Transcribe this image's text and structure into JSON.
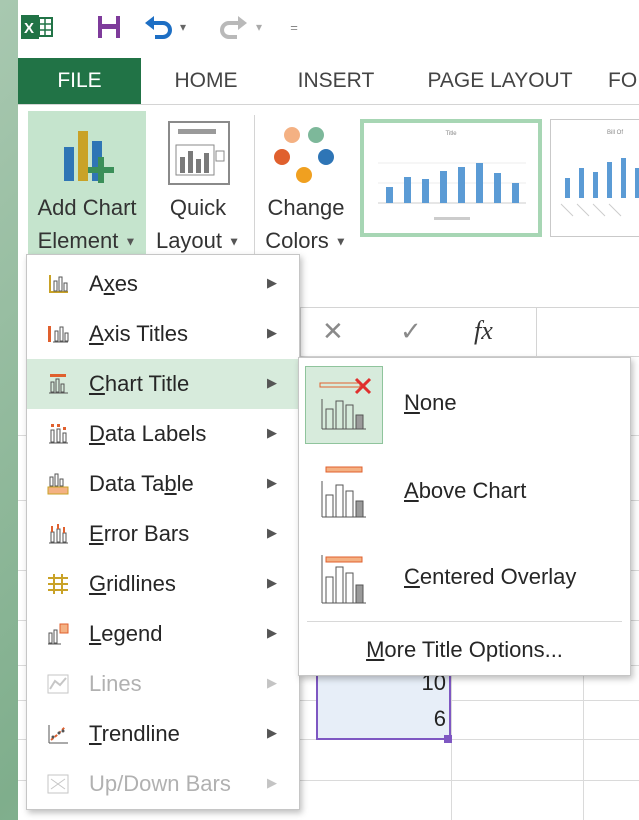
{
  "qat": {
    "undo_caret": "▾",
    "redo_caret": "▾",
    "customize": "="
  },
  "tabs": [
    "FILE",
    "HOME",
    "INSERT",
    "PAGE LAYOUT",
    "FO"
  ],
  "ribbon": {
    "add_chart_line1": "Add Chart",
    "add_chart_line2": "Element",
    "quick_line1": "Quick",
    "quick_line2": "Layout",
    "change_line1": "Change",
    "change_line2": "Colors",
    "thumb1_title": "Title",
    "thumb2_title": "Bill Of"
  },
  "formula_bar": {
    "cancel": "✕",
    "enter": "✓",
    "fx": "fx"
  },
  "cells": {
    "value1": "10",
    "value2": "6"
  },
  "menu": {
    "items": [
      {
        "pre": "A",
        "key": "x",
        "post": "es",
        "disabled": false
      },
      {
        "pre": "",
        "key": "A",
        "post": "xis Titles",
        "disabled": false
      },
      {
        "pre": "",
        "key": "C",
        "post": "hart Title",
        "disabled": false,
        "highlighted": true
      },
      {
        "pre": "",
        "key": "D",
        "post": "ata Labels",
        "disabled": false
      },
      {
        "pre": "Data Ta",
        "key": "b",
        "post": "le",
        "disabled": false
      },
      {
        "pre": "",
        "key": "E",
        "post": "rror Bars",
        "disabled": false
      },
      {
        "pre": "",
        "key": "G",
        "post": "ridlines",
        "disabled": false
      },
      {
        "pre": "",
        "key": "L",
        "post": "egend",
        "disabled": false
      },
      {
        "pre": "",
        "key": "",
        "post": "Lines",
        "disabled": true
      },
      {
        "pre": "",
        "key": "T",
        "post": "rendline",
        "disabled": false
      },
      {
        "pre": "",
        "key": "",
        "post": "Up/Down Bars",
        "disabled": true
      }
    ]
  },
  "submenu": {
    "options": [
      {
        "key": "N",
        "post": "one"
      },
      {
        "key": "A",
        "post": "bove Chart"
      },
      {
        "key": "C",
        "post": "entered Overlay"
      }
    ],
    "more_key": "M",
    "more_post": "ore Title Options..."
  },
  "colors": {
    "excel_green": "#217346",
    "highlight": "#d7ebdc",
    "ribbon_active": "#c5e4cd",
    "selection_border": "#7e57c2"
  }
}
